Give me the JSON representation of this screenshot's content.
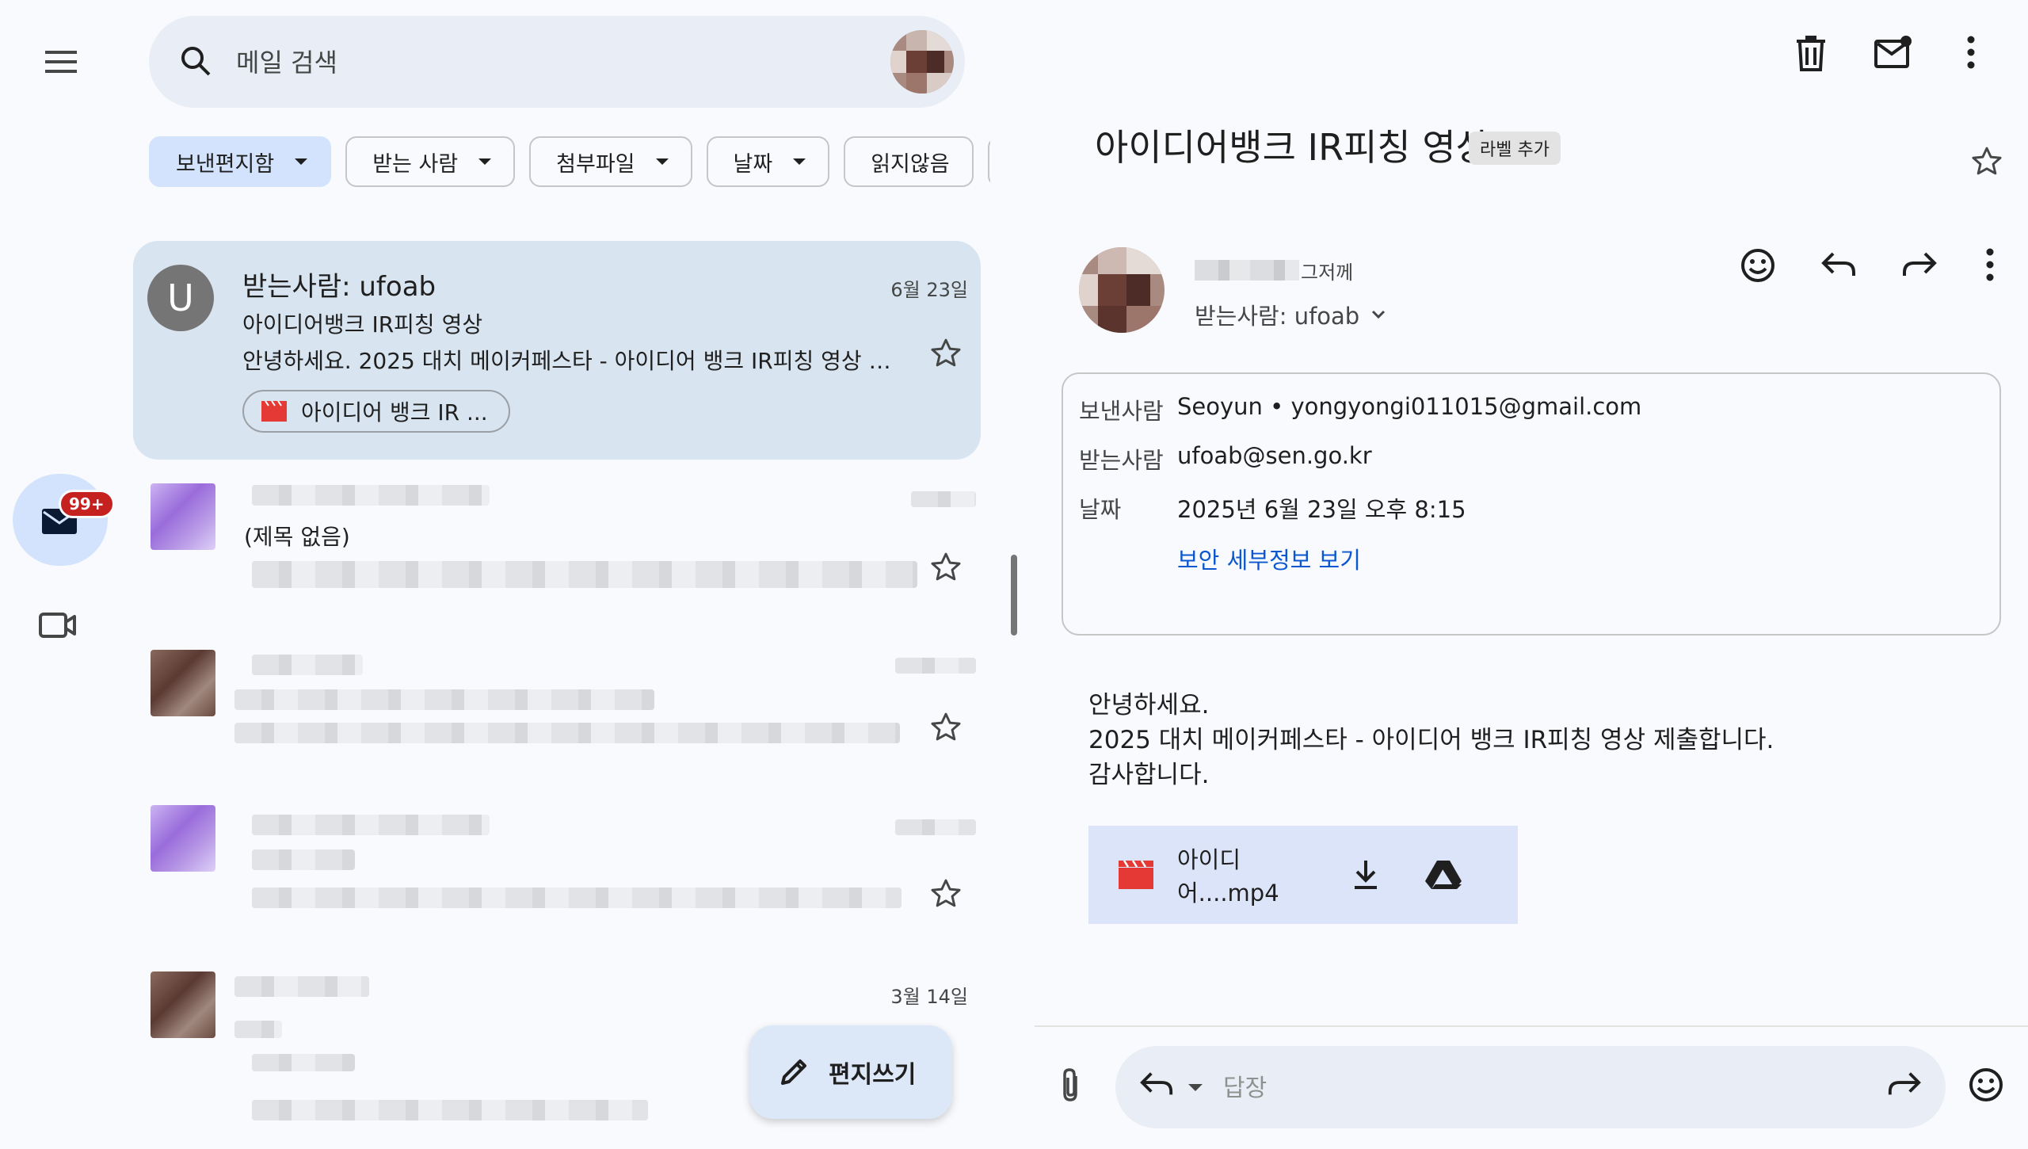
{
  "search": {
    "placeholder": "메일 검색"
  },
  "rail": {
    "mail_badge": "99+"
  },
  "filters": [
    {
      "label": "보낸편지함"
    },
    {
      "label": "받는 사람"
    },
    {
      "label": "첨부파일"
    },
    {
      "label": "날짜"
    },
    {
      "label": "읽지않음"
    }
  ],
  "messages": {
    "selected": {
      "avatar_letter": "U",
      "from": "받는사람: ufoab",
      "date": "6월 23일",
      "subject": "아이디어뱅크 IR피칭 영상",
      "snippet": "안녕하세요. 2025 대치 메이커페스타 - 아이디어 뱅크 IR피칭 영상 제...",
      "attachment": "아이디어 뱅크 IR ..."
    },
    "second": {
      "subject": "(제목 없음)"
    },
    "fifth": {
      "date": "3월 14일"
    }
  },
  "compose": {
    "label": "편지쓰기"
  },
  "reading": {
    "subject": "아이디어뱅크 IR피칭 영상",
    "label_chip": "라벨 추가",
    "sender_time": "그저께",
    "to_line": "받는사람: ufoab",
    "details": {
      "from_key": "보낸사람",
      "from_val": "Seoyun • yongyongi011015@gmail.com",
      "to_key": "받는사람",
      "to_val": "ufoab@sen.go.kr",
      "date_key": "날짜",
      "date_val": "2025년 6월 23일 오후 8:15",
      "security_link": "보안 세부정보 보기"
    },
    "body": [
      "안녕하세요.",
      "2025 대치 메이커페스타 - 아이디어 뱅크 IR피칭 영상 제출합니다.",
      "감사합니다."
    ],
    "attachment_name": "아이디어....mp4",
    "reply_placeholder": "답장"
  },
  "colors": {
    "selected_row": "#d8e4f0",
    "active_chip": "#d3e3fd",
    "link": "#0b57d0",
    "badge": "#c5221f",
    "video_red": "#e53935"
  },
  "icons": {
    "menu": "menu-icon",
    "search": "search-icon",
    "mail": "mail-icon",
    "video": "video-icon",
    "star": "star-icon",
    "trash": "trash-icon",
    "mark_unread": "mark-unread-icon",
    "more": "more-vert-icon",
    "emoji": "emoji-icon",
    "reply": "reply-icon",
    "forward": "forward-icon",
    "download": "download-icon",
    "drive": "drive-icon",
    "attach": "paperclip-icon",
    "edit": "pencil-icon"
  }
}
